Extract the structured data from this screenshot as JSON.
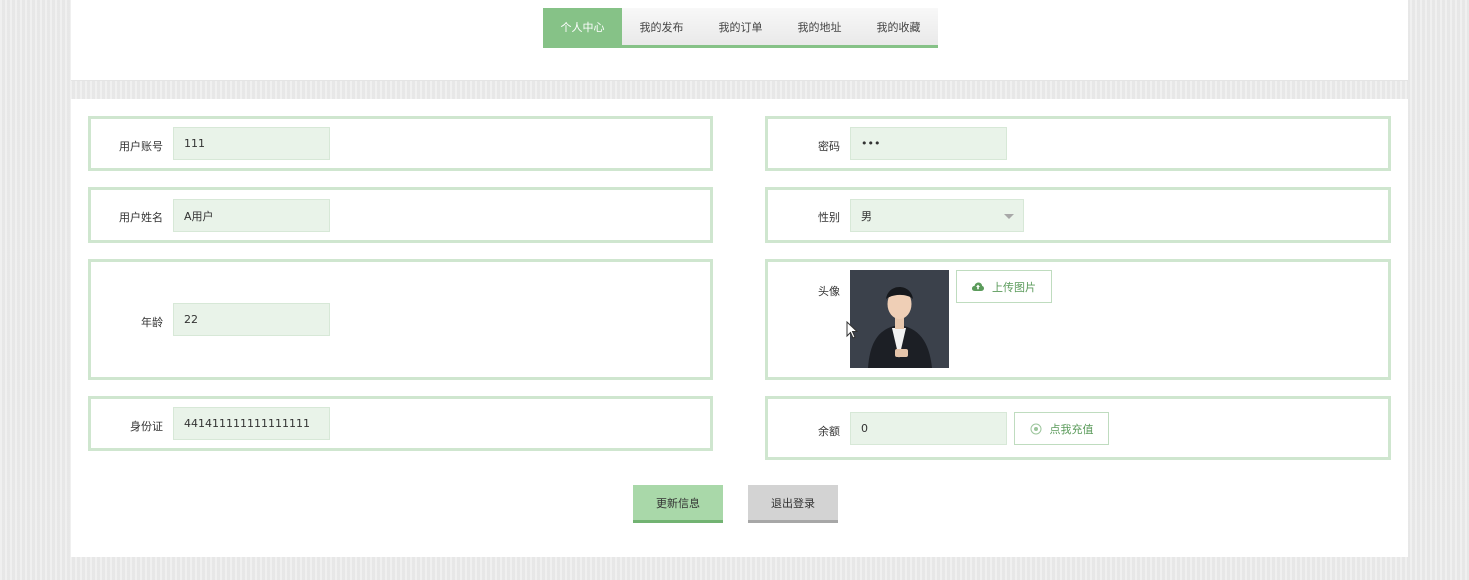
{
  "tabs": [
    {
      "label": "个人中心",
      "active": true
    },
    {
      "label": "我的发布",
      "active": false
    },
    {
      "label": "我的订单",
      "active": false
    },
    {
      "label": "我的地址",
      "active": false
    },
    {
      "label": "我的收藏",
      "active": false
    }
  ],
  "form": {
    "account_label": "用户账号",
    "account_value": "111",
    "password_label": "密码",
    "password_value": "•••",
    "name_label": "用户姓名",
    "name_value": "A用户",
    "gender_label": "性别",
    "gender_value": "男",
    "age_label": "年龄",
    "age_value": "22",
    "avatar_label": "头像",
    "upload_label": "上传图片",
    "id_label": "身份证",
    "id_value": "441411111111111111",
    "balance_label": "余额",
    "balance_value": "0",
    "recharge_label": "点我充值"
  },
  "actions": {
    "update_label": "更新信息",
    "logout_label": "退出登录"
  },
  "colors": {
    "accent": "#86c287",
    "input_bg": "#e9f3e9",
    "box_border": "#cfe6cf"
  },
  "icons": {
    "upload": "cloud-upload-icon",
    "recharge": "coin-icon"
  }
}
